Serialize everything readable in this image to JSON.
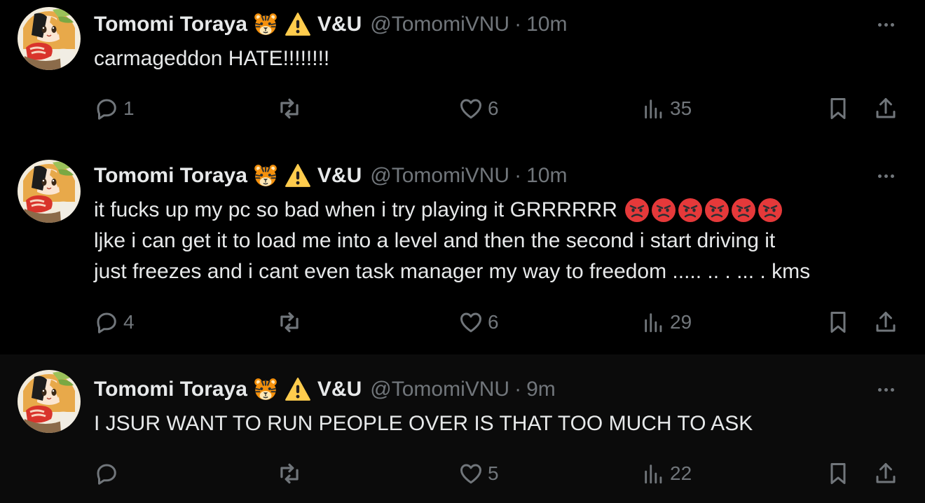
{
  "colors": {
    "background": "#000000",
    "highlight_background": "#0b0b0b",
    "text_primary": "#e7e9ea",
    "text_secondary": "#71767b",
    "thread_line": "#333639",
    "emoji_angry": "#e5393a"
  },
  "icons": {
    "author_emoji_1": "tiger-face-icon",
    "author_emoji_2": "warning-sign-icon",
    "reply": "speech-bubble-icon",
    "repost": "repost-arrows-icon",
    "like": "heart-icon",
    "views": "bar-chart-icon",
    "bookmark": "bookmark-icon",
    "share": "share-upload-icon",
    "more": "ellipsis-icon",
    "text_emoji": "angry-face-icon"
  },
  "tweets": [
    {
      "author": {
        "name": "Tomomi Toraya",
        "suffix": "V&U",
        "handle": "@TomomiVNU"
      },
      "separator": "·",
      "time": "10m",
      "text_lines": [
        "carmageddon HATE!!!!!!!!"
      ],
      "stats": {
        "replies": "1",
        "reposts": "",
        "likes": "6",
        "views": "35"
      }
    },
    {
      "author": {
        "name": "Tomomi Toraya",
        "suffix": "V&U",
        "handle": "@TomomiVNU"
      },
      "separator": "·",
      "time": "10m",
      "text_lines": [
        "it fucks up my pc so bad when i try playing it GRRRRRR",
        "ljke i can get it to load me into a level and then the second i start driving it",
        "just freezes and i cant even task manager my way to freedom ..... .. . ... .  kms"
      ],
      "angry_emoji_count": 6,
      "stats": {
        "replies": "4",
        "reposts": "",
        "likes": "6",
        "views": "29"
      }
    },
    {
      "author": {
        "name": "Tomomi Toraya",
        "suffix": "V&U",
        "handle": "@TomomiVNU"
      },
      "separator": "·",
      "time": "9m",
      "text_lines": [
        "I JSUR WANT TO RUN PEOPLE OVER IS THAT TOO MUCH TO ASK"
      ],
      "stats": {
        "replies": "",
        "reposts": "",
        "likes": "5",
        "views": "22"
      }
    }
  ]
}
